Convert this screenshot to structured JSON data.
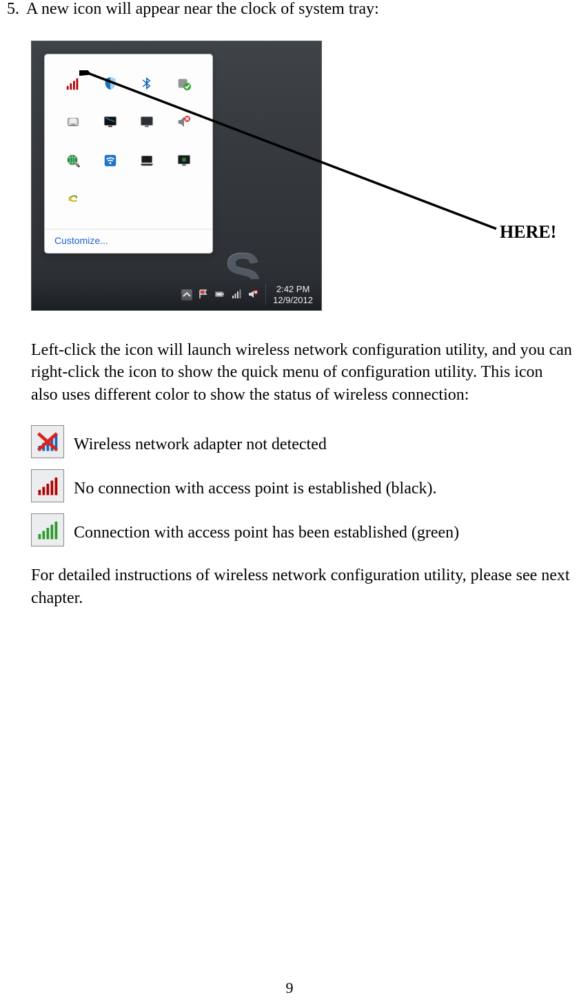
{
  "step": {
    "number": "5.",
    "text": "A new icon will appear near the clock of system tray:"
  },
  "screenshot": {
    "tray_icons": [
      "signal-bars-red-icon",
      "shield-blue-icon",
      "bluetooth-icon",
      "green-check-icon",
      "drive-icon",
      "monitor-black-icon",
      "display-icon",
      "speaker-muted-icon",
      "globe-icon",
      "wifi-blue-icon",
      "laptop-dark-icon",
      "gpu-icon",
      "arrows-yellow-icon"
    ],
    "customize_label": "Customize...",
    "taskbar": {
      "tray_small_icons": [
        "chevron-up-icon",
        "flag-icon",
        "battery-icon",
        "network-icon",
        "volume-muted-icon"
      ],
      "time": "2:42 PM",
      "date": "12/9/2012"
    }
  },
  "callout": "HERE!",
  "paragraph1": "Left-click the icon will launch wireless network configuration utility, and you can right-click the icon to show the quick menu of configuration utility. This icon also uses different color to show the status of wireless connection:",
  "status": [
    {
      "label": "Wireless network adapter not detected"
    },
    {
      "label": "No connection with access point is established (black)."
    },
    {
      "label": "Connection with access point has been established (green)"
    }
  ],
  "paragraph2": "For detailed instructions of wireless network configuration utility, please see next chapter.",
  "page_number": "9"
}
